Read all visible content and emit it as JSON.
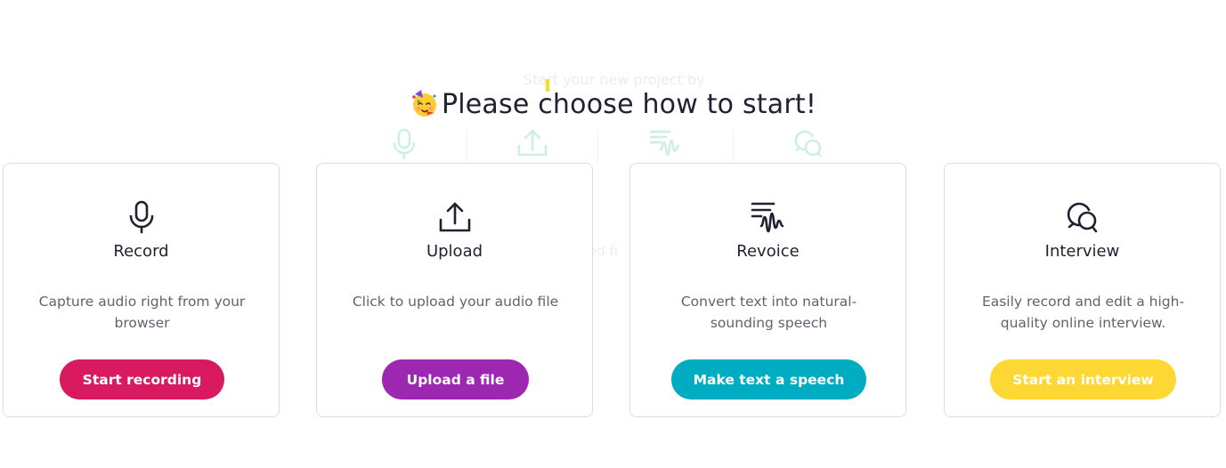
{
  "background": {
    "subtitle": "Start your new project by",
    "fragment": "ed fi"
  },
  "heading": {
    "emoji_icon": "partying-face-icon",
    "text": "Please choose how to start!"
  },
  "cards": [
    {
      "id": "record",
      "icon": "microphone-icon",
      "title": "Record",
      "description": "Capture audio right from your browser",
      "button_label": "Start recording",
      "button_color": "#d81b60"
    },
    {
      "id": "upload",
      "icon": "upload-icon",
      "title": "Upload",
      "description": "Click to upload your audio file",
      "button_label": "Upload a file",
      "button_color": "#9c27b0"
    },
    {
      "id": "revoice",
      "icon": "revoice-waveform-icon",
      "title": "Revoice",
      "description": "Convert text into natural-sounding speech",
      "button_label": "Make text a speech",
      "button_color": "#00acc1"
    },
    {
      "id": "interview",
      "icon": "chat-bubbles-icon",
      "title": "Interview",
      "description": "Easily record and edit a high-quality online interview.",
      "button_label": "Start an interview",
      "button_color": "#fdd835"
    }
  ]
}
